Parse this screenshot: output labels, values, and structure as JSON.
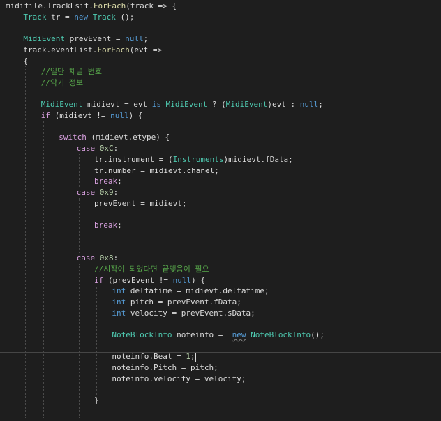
{
  "colors": {
    "background": "#1e1e1e",
    "default": "#dcdcdc",
    "keyword": "#569cd6",
    "control": "#d8a0df",
    "type": "#4ec9b0",
    "method": "#dcdcaa",
    "variable": "#9cdcfe",
    "number": "#b5cea8",
    "comment": "#57a64a",
    "guide": "#4a4a4a"
  },
  "code_lines": [
    {
      "indent": 0,
      "tokens": [
        [
          "midifile",
          "default"
        ],
        [
          ".",
          "default"
        ],
        [
          "TrackLsit",
          "default"
        ],
        [
          ".",
          "default"
        ],
        [
          "ForEach",
          "method"
        ],
        [
          "(track => {",
          "default"
        ]
      ]
    },
    {
      "indent": 1,
      "tokens": [
        [
          "Track",
          "type"
        ],
        [
          " tr = ",
          "default"
        ],
        [
          "new",
          "keyword"
        ],
        [
          " ",
          "default"
        ],
        [
          "Track",
          "type"
        ],
        [
          " ();",
          "default"
        ]
      ]
    },
    {
      "indent": 0,
      "tokens": []
    },
    {
      "indent": 1,
      "tokens": [
        [
          "MidiEvent",
          "type"
        ],
        [
          " prevEvent = ",
          "default"
        ],
        [
          "null",
          "keyword"
        ],
        [
          ";",
          "default"
        ]
      ]
    },
    {
      "indent": 1,
      "tokens": [
        [
          "track",
          "default"
        ],
        [
          ".",
          "default"
        ],
        [
          "eventList",
          "default"
        ],
        [
          ".",
          "default"
        ],
        [
          "ForEach",
          "method"
        ],
        [
          "(evt =>",
          "default"
        ]
      ]
    },
    {
      "indent": 1,
      "tokens": [
        [
          "{",
          "default"
        ]
      ]
    },
    {
      "indent": 2,
      "tokens": [
        [
          "//일단 채널 번호",
          "comment"
        ]
      ]
    },
    {
      "indent": 2,
      "tokens": [
        [
          "//악기 정보",
          "comment"
        ]
      ]
    },
    {
      "indent": 0,
      "tokens": []
    },
    {
      "indent": 2,
      "tokens": [
        [
          "MidiEvent",
          "type"
        ],
        [
          " midievt = ",
          "default"
        ],
        [
          "evt",
          "default"
        ],
        [
          " ",
          "default"
        ],
        [
          "is",
          "keyword"
        ],
        [
          " ",
          "default"
        ],
        [
          "MidiEvent",
          "type"
        ],
        [
          " ? (",
          "default"
        ],
        [
          "MidiEvent",
          "type"
        ],
        [
          ")evt : ",
          "default"
        ],
        [
          "null",
          "keyword"
        ],
        [
          ";",
          "default"
        ]
      ]
    },
    {
      "indent": 2,
      "tokens": [
        [
          "if",
          "control"
        ],
        [
          " (midievt != ",
          "default"
        ],
        [
          "null",
          "keyword"
        ],
        [
          ") {",
          "default"
        ]
      ]
    },
    {
      "indent": 0,
      "tokens": []
    },
    {
      "indent": 3,
      "tokens": [
        [
          "switch",
          "control"
        ],
        [
          " (midievt.etype) {",
          "default"
        ]
      ]
    },
    {
      "indent": 4,
      "tokens": [
        [
          "case",
          "control"
        ],
        [
          " ",
          "default"
        ],
        [
          "0xC",
          "number"
        ],
        [
          ":",
          "default"
        ]
      ]
    },
    {
      "indent": 5,
      "tokens": [
        [
          "tr",
          "default"
        ],
        [
          ".",
          "default"
        ],
        [
          "instrument",
          "default"
        ],
        [
          " = (",
          "default"
        ],
        [
          "Instruments",
          "type"
        ],
        [
          ")midievt.fData;",
          "default"
        ]
      ]
    },
    {
      "indent": 5,
      "tokens": [
        [
          "tr",
          "default"
        ],
        [
          ".",
          "default"
        ],
        [
          "number",
          "default"
        ],
        [
          " = midievt.chanel;",
          "default"
        ]
      ]
    },
    {
      "indent": 5,
      "tokens": [
        [
          "break",
          "control"
        ],
        [
          ";",
          "default"
        ]
      ]
    },
    {
      "indent": 4,
      "tokens": [
        [
          "case",
          "control"
        ],
        [
          " ",
          "default"
        ],
        [
          "0x9",
          "number"
        ],
        [
          ":",
          "default"
        ]
      ]
    },
    {
      "indent": 5,
      "tokens": [
        [
          "prevEvent",
          "default"
        ],
        [
          " = midievt;",
          "default"
        ]
      ]
    },
    {
      "indent": 0,
      "tokens": []
    },
    {
      "indent": 5,
      "tokens": [
        [
          "break",
          "control"
        ],
        [
          ";",
          "default"
        ]
      ]
    },
    {
      "indent": 0,
      "tokens": []
    },
    {
      "indent": 0,
      "tokens": []
    },
    {
      "indent": 4,
      "tokens": [
        [
          "case",
          "control"
        ],
        [
          " ",
          "default"
        ],
        [
          "0x8",
          "number"
        ],
        [
          ":",
          "default"
        ]
      ]
    },
    {
      "indent": 5,
      "tokens": [
        [
          "//시작이 되었다면 끝맺음이 필요",
          "comment"
        ]
      ]
    },
    {
      "indent": 5,
      "tokens": [
        [
          "if",
          "control"
        ],
        [
          " (prevEvent != ",
          "default"
        ],
        [
          "null",
          "keyword"
        ],
        [
          ") {",
          "default"
        ]
      ]
    },
    {
      "indent": 6,
      "tokens": [
        [
          "int",
          "keyword"
        ],
        [
          " deltatime = midievt.deltatime;",
          "default"
        ]
      ]
    },
    {
      "indent": 6,
      "tokens": [
        [
          "int",
          "keyword"
        ],
        [
          " pitch = prevEvent.fData;",
          "default"
        ]
      ]
    },
    {
      "indent": 6,
      "tokens": [
        [
          "int",
          "keyword"
        ],
        [
          " velocity = prevEvent.sData;",
          "default"
        ]
      ]
    },
    {
      "indent": 0,
      "tokens": []
    },
    {
      "indent": 6,
      "tokens": [
        [
          "NoteBlockInfo",
          "type"
        ],
        [
          " noteinfo =  ",
          "default"
        ],
        [
          "new",
          "keyword"
        ],
        [
          " ",
          "default"
        ],
        [
          "NoteBlockInfo",
          "type"
        ],
        [
          "();",
          "default"
        ]
      ]
    },
    {
      "indent": 0,
      "tokens": []
    },
    {
      "indent": 6,
      "tokens": [
        [
          "noteinfo",
          "default"
        ],
        [
          ".",
          "default"
        ],
        [
          "Beat",
          "default"
        ],
        [
          " = ",
          "default"
        ],
        [
          "1",
          "number"
        ],
        [
          ";",
          "default"
        ]
      ],
      "cursor": true
    },
    {
      "indent": 6,
      "tokens": [
        [
          "noteinfo",
          "default"
        ],
        [
          ".",
          "default"
        ],
        [
          "Pitch",
          "default"
        ],
        [
          " = pitch;",
          "default"
        ]
      ]
    },
    {
      "indent": 6,
      "tokens": [
        [
          "noteinfo",
          "default"
        ],
        [
          ".",
          "default"
        ],
        [
          "velocity",
          "default"
        ],
        [
          " = velocity;",
          "default"
        ]
      ]
    },
    {
      "indent": 0,
      "tokens": []
    },
    {
      "indent": 5,
      "tokens": [
        [
          "}",
          "default"
        ]
      ]
    },
    {
      "indent": 0,
      "tokens": []
    }
  ]
}
